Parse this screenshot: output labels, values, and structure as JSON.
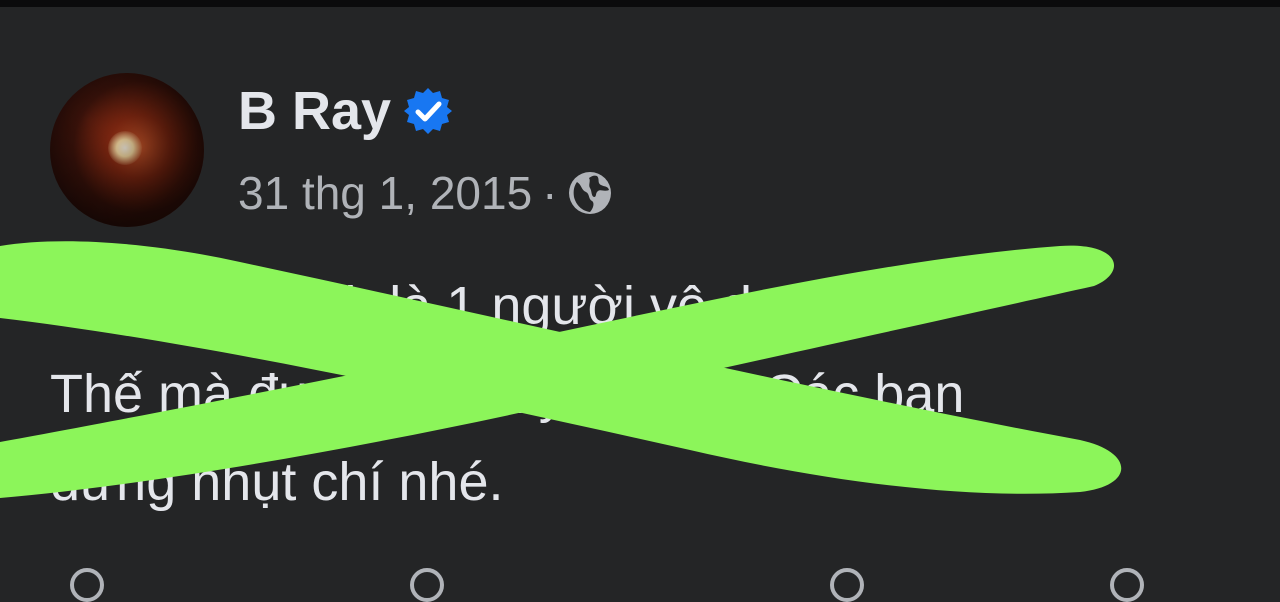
{
  "post": {
    "author": "B Ray",
    "date": "31 thg 1, 2015",
    "separator": "·",
    "privacy_icon": "globe-icon",
    "verified_icon": "verified-badge-icon",
    "lines": [
      "Hồi xưa mình là 1 người vô danh",
      "Thế mà được lên đây cơ mà. Các bạn",
      "đừng nhụt chí nhé."
    ]
  },
  "colors": {
    "background": "#242526",
    "primary_text": "#e4e6eb",
    "secondary_text": "#b0b3b8",
    "verified": "#1877f2",
    "overlay_cross": "#8cf55a"
  }
}
